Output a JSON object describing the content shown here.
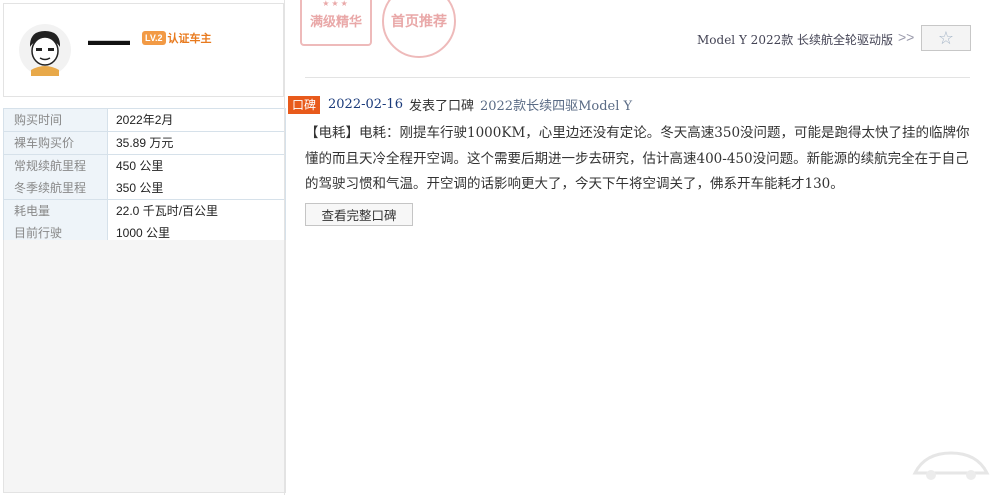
{
  "profile": {
    "username": "▬▬▬",
    "badge_level": "LV.2",
    "badge_text": "认证车主"
  },
  "specs": [
    {
      "label": "购买时间",
      "value": "2022年2月"
    },
    {
      "label": "裸车购买价",
      "value": "35.89 万元"
    },
    {
      "label": "常规续航里程",
      "value": "450 公里"
    },
    {
      "label": "冬季续航里程",
      "value": "350 公里"
    },
    {
      "label": "耗电量",
      "value": "22.0 千瓦时/百公里"
    },
    {
      "label": "目前行驶",
      "value": "1000 公里"
    }
  ],
  "stamps": {
    "one": "满级精华",
    "two": "首页推荐"
  },
  "header": {
    "model": "Model Y 2022款 长续航全轮驱动版",
    "chevrons": ">>",
    "favorite_icon": "☆"
  },
  "post": {
    "tag": "口碑",
    "date": "2022-02-16",
    "action": "发表了口碑",
    "model": "2022款长续四驱Model Y",
    "body": "【电耗】电耗：刚提车行驶1000KM，心里边还没有定论。冬天高速350没问题，可能是跑得太快了挂的临牌你懂的而且天冷全程开空调。这个需要后期进一步去研究，估计高速400-450没问题。新能源的续航完全在于自己的驾驶习惯和气温。开空调的话影响更大了，今天下午将空调关了，佛系开车能耗才130。",
    "full_button": "查看完整口碑"
  }
}
